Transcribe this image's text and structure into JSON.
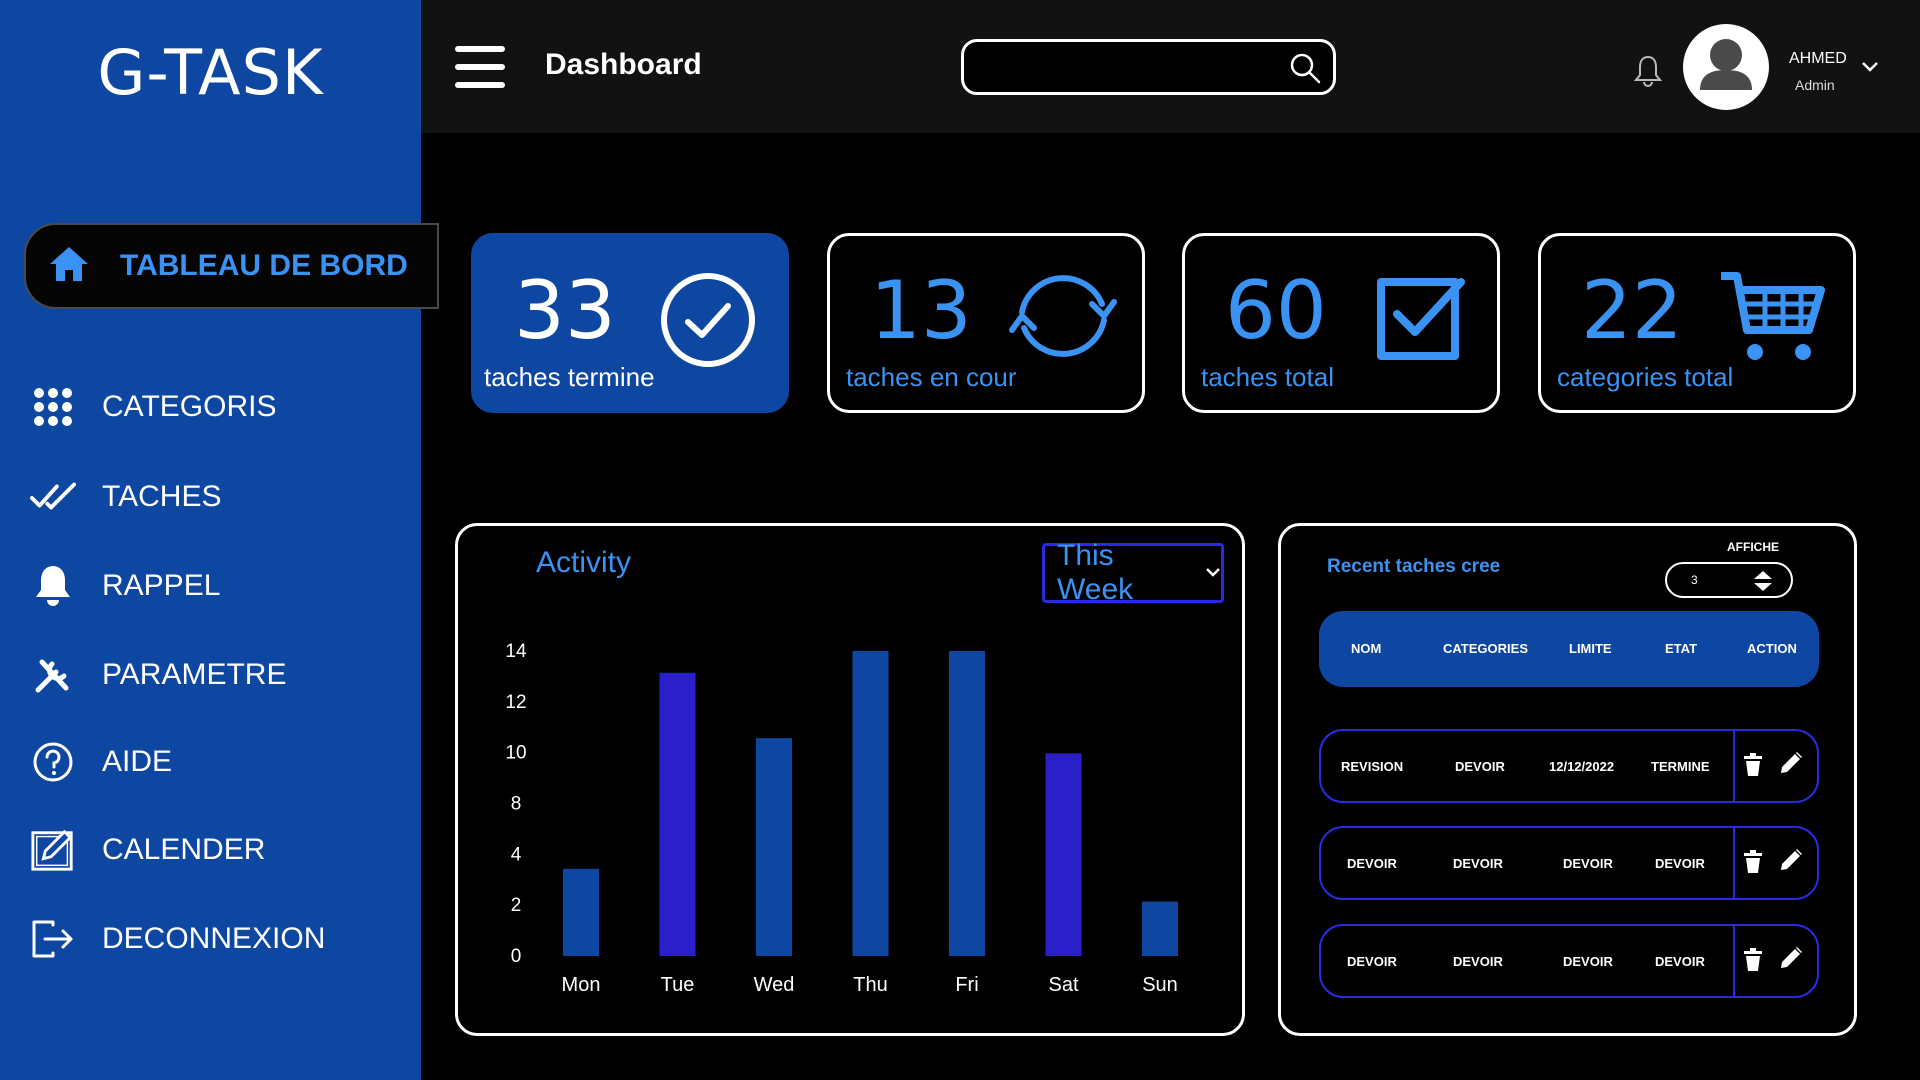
{
  "app": {
    "logo": "G-TASK"
  },
  "sidebar": {
    "active": {
      "label": "TABLEAU DE BORD",
      "icon": "home-icon"
    },
    "items": [
      {
        "label": "CATEGORIS",
        "icon": "grid-dots-icon"
      },
      {
        "label": "TACHES",
        "icon": "double-check-icon"
      },
      {
        "label": "RAPPEL",
        "icon": "bell-icon"
      },
      {
        "label": "PARAMETRE",
        "icon": "tools-icon"
      },
      {
        "label": "AIDE",
        "icon": "help-icon"
      },
      {
        "label": "CALENDER",
        "icon": "calendar-edit-icon"
      },
      {
        "label": "DECONNEXION",
        "icon": "logout-icon"
      }
    ]
  },
  "header": {
    "title": "Dashboard",
    "search": {
      "value": "",
      "placeholder": ""
    },
    "user": {
      "name": "AHMED",
      "role": "Admin"
    }
  },
  "stats": [
    {
      "value": "33",
      "caption": "taches termine",
      "icon": "check-circle-icon"
    },
    {
      "value": "13",
      "caption": "taches en cour",
      "icon": "refresh-icon"
    },
    {
      "value": "60",
      "caption": "taches total",
      "icon": "checkbox-icon"
    },
    {
      "value": "22",
      "caption": "categories total",
      "icon": "cart-icon"
    }
  ],
  "activity": {
    "title": "Activity",
    "period": "This Week"
  },
  "chart_data": {
    "type": "bar",
    "title": "Activity",
    "categories": [
      "Mon",
      "Tue",
      "Wed",
      "Thu",
      "Fri",
      "Sat",
      "Sun"
    ],
    "values": [
      4,
      13,
      10,
      14,
      14,
      9.3,
      2.5
    ],
    "yticks": [
      "0",
      "2",
      "4",
      "8",
      "10",
      "12",
      "14"
    ],
    "ylim": [
      0,
      14
    ],
    "colors": [
      "#0e47a1",
      "#2a1fc9",
      "#0e47a1",
      "#0e47a1",
      "#0e47a1",
      "#2a1fc9",
      "#0e47a1"
    ],
    "grid": false
  },
  "recent": {
    "title": "Recent taches cree",
    "affiche_label": "AFFICHE",
    "affiche_value": "3",
    "columns": [
      "NOM",
      "CATEGORIES",
      "LIMITE",
      "ETAT",
      "ACTION"
    ],
    "rows": [
      [
        "REVISION",
        "DEVOIR",
        "12/12/2022",
        "TERMINE"
      ],
      [
        "DEVOIR",
        "DEVOIR",
        "DEVOIR",
        "DEVOIR"
      ],
      [
        "DEVOIR",
        "DEVOIR",
        "DEVOIR",
        "DEVOIR"
      ]
    ]
  },
  "colors": {
    "accent": "#3a93f3",
    "sidebar": "#0e47a1",
    "bar_highlight": "#2a1fc9"
  }
}
